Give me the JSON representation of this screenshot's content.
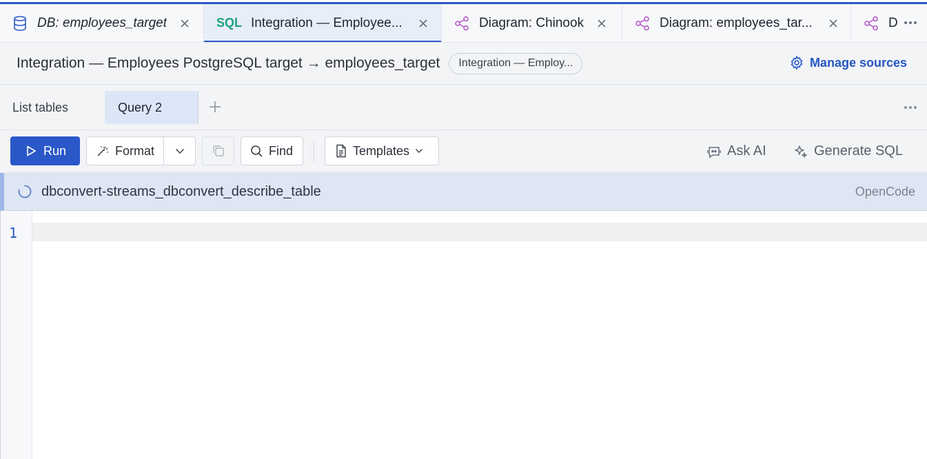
{
  "tabs": [
    {
      "prefix": "",
      "label": "DB: employees_target",
      "icon": "database-icon",
      "style": "italic"
    },
    {
      "prefix": "SQL",
      "label": "Integration — Employee...",
      "icon": "",
      "style": "active"
    },
    {
      "prefix": "",
      "label": "Diagram: Chinook",
      "icon": "diagram-share-icon",
      "style": "normal"
    },
    {
      "prefix": "",
      "label": "Diagram: employees_tar...",
      "icon": "diagram-share-icon",
      "style": "normal"
    },
    {
      "prefix": "",
      "label": "D",
      "icon": "diagram-share-icon",
      "style": "normal"
    }
  ],
  "header": {
    "title": "Integration — Employees PostgreSQL target → employees_target",
    "connection_pill": "Integration — Employ...",
    "manage_sources": "Manage sources"
  },
  "query_tabs": {
    "list_tables": "List tables",
    "active": "Query 2"
  },
  "toolbar": {
    "run": "Run",
    "format": "Format",
    "find": "Find",
    "templates": "Templates",
    "ask_ai": "Ask AI",
    "generate_sql": "Generate SQL"
  },
  "status": {
    "text": "dbconvert-streams_dbconvert_describe_table",
    "source": "OpenCode"
  },
  "editor": {
    "line_numbers": [
      "1"
    ]
  },
  "colors": {
    "accent": "#2a58c8",
    "sql_prefix": "#1aa37a",
    "diagram_icon": "#b44fc7",
    "banner": "#dfe6f3"
  }
}
